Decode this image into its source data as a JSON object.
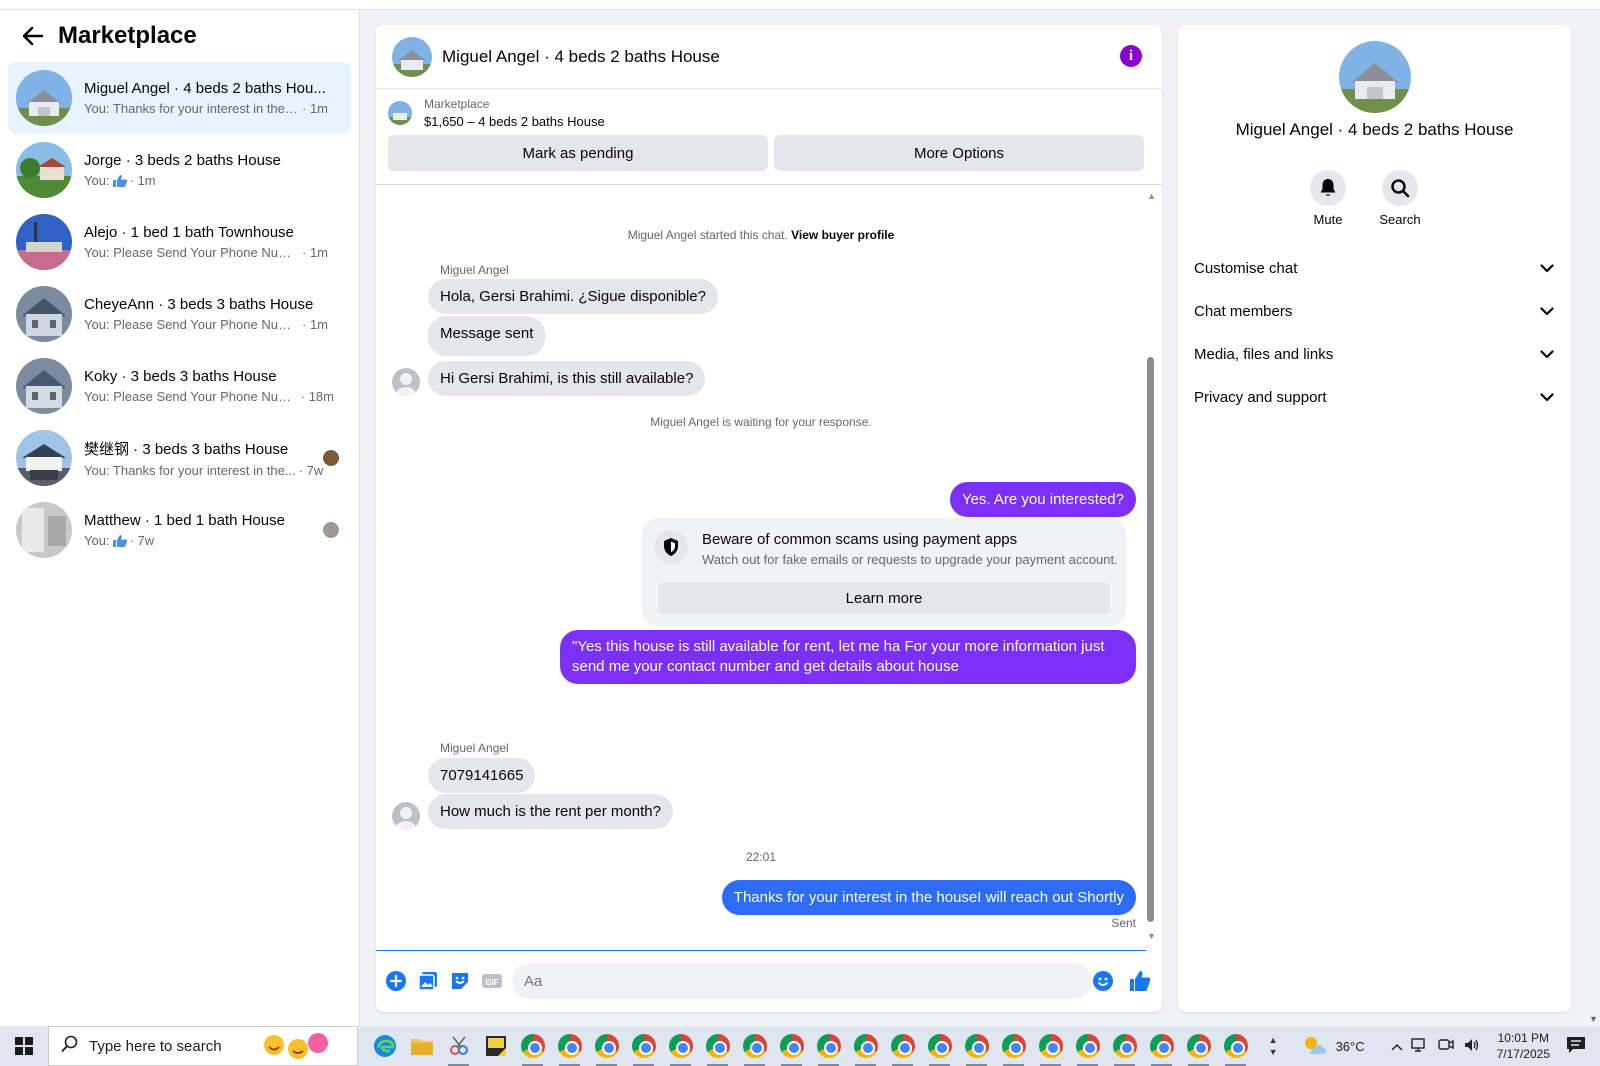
{
  "sidebar": {
    "title": "Marketplace",
    "conversations": [
      {
        "name": "Miguel Angel · 4 beds 2 baths Hou...",
        "snippet": "You: Thanks for your interest in the h...",
        "time": "· 1m",
        "active": true
      },
      {
        "name": "Jorge · 3 beds 2 baths House",
        "snippet": "You:",
        "time": "· 1m",
        "like": true
      },
      {
        "name": "Alejo · 1 bed 1 bath Townhouse",
        "snippet": "You: Please Send Your Phone Numbe...",
        "time": "· 1m"
      },
      {
        "name": "CheyeAnn · 3 beds 3 baths House",
        "snippet": "You: Please Send Your Phone Numbe...",
        "time": "· 1m"
      },
      {
        "name": "Koky · 3 beds 3 baths House",
        "snippet": "You: Please Send Your Phone Numb...",
        "time": "· 18m"
      },
      {
        "name": "樊继钢 · 3 beds 3 baths House",
        "snippet": "You: Thanks for your interest in the...",
        "time": "· 7w"
      },
      {
        "name": "Matthew · 1 bed 1 bath House",
        "snippet": "You:",
        "time": "· 7w",
        "like": true
      }
    ]
  },
  "chat": {
    "title": "Miguel Angel · 4 beds 2 baths House",
    "listing": {
      "source": "Marketplace",
      "price_title": "$1,650 – 4 beds 2 baths House"
    },
    "buttons": {
      "pending": "Mark as pending",
      "more": "More Options"
    },
    "started": {
      "text": "Miguel Angel started this chat.",
      "link": "View buyer profile"
    },
    "sender_name": "Miguel Angel",
    "msg1": "Hola, Gersi Brahimi. ¿Sigue disponible?",
    "msg2": "Message sent",
    "msg3": "Hi Gersi Brahimi, is this still available?",
    "waiting": "Miguel Angel is waiting for your response.",
    "out1": "Yes. Are you interested?",
    "scam": {
      "title": "Beware of common scams using payment apps",
      "subtitle": "Watch out for fake emails or requests to upgrade your payment account.",
      "button": "Learn more"
    },
    "out2": "\"Yes this house is still available for rent, let me ha For  your  more  information  just send  me   your  contact  number  and get details about house",
    "sender_name2": "Miguel Angel",
    "msg4": "7079141665",
    "msg5": "How much is the rent per month?",
    "timestamp": "22:01",
    "out3": "Thanks for your interest in the houseI will reach out Shortly",
    "sent_status": "Sent",
    "composer_placeholder": "Aa"
  },
  "info": {
    "title": "Miguel Angel · 4 beds 2 baths House",
    "actions": {
      "mute": "Mute",
      "search": "Search"
    },
    "sections": [
      "Customise chat",
      "Chat members",
      "Media, files and links",
      "Privacy and support"
    ]
  },
  "taskbar": {
    "search_placeholder": "Type here to search",
    "weather": "36°C",
    "time": "10:01 PM",
    "date": "7/17/2025"
  },
  "colors": {
    "accent": "#1877f2",
    "bubble_out": "#7b2ff7",
    "bubble_in": "#e4e6eb",
    "info_icon": "#8a00d4"
  }
}
